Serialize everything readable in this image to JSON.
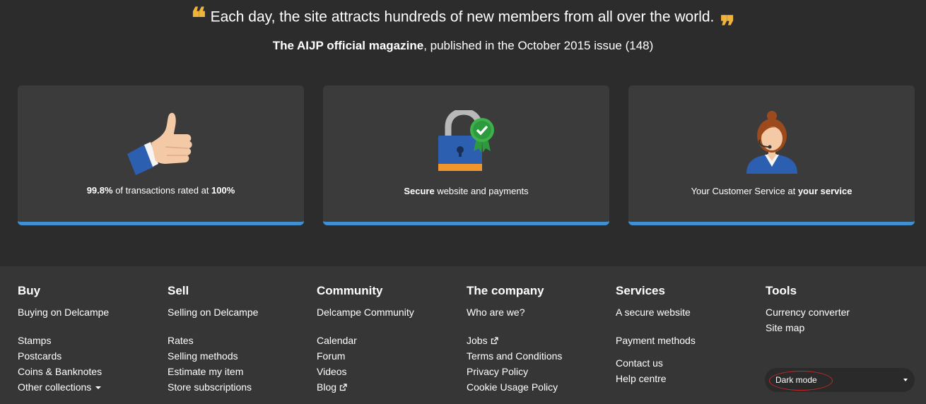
{
  "quote": {
    "open_mark": "❝",
    "text": "Each day, the site attracts hundreds of new members from all over the world.",
    "close_mark": "❞",
    "source_bold": "The AIJP official magazine",
    "source_rest": ", published in the October 2015 issue (148)"
  },
  "cards": [
    {
      "icon": "thumbs-up-icon",
      "bold_lead": "99.8%",
      "text_mid": " of transactions rated at ",
      "bold_tail": "100%"
    },
    {
      "icon": "secure-lock-icon",
      "bold_lead": "Secure",
      "text_mid": " website and payments",
      "bold_tail": ""
    },
    {
      "icon": "customer-service-icon",
      "bold_lead": "",
      "text_mid": "Your Customer Service at ",
      "bold_tail": "your service"
    }
  ],
  "footer": {
    "buy": {
      "title": "Buy",
      "items": [
        "Buying on Delcampe",
        "Stamps",
        "Postcards",
        "Coins & Banknotes",
        "Other collections"
      ]
    },
    "sell": {
      "title": "Sell",
      "items": [
        "Selling on Delcampe",
        "Rates",
        "Selling methods",
        "Estimate my item",
        "Store subscriptions"
      ]
    },
    "community": {
      "title": "Community",
      "items": [
        "Delcampe Community",
        "Calendar",
        "Forum",
        "Videos",
        "Blog"
      ]
    },
    "company": {
      "title": "The company",
      "items": [
        "Who are we?",
        "Jobs",
        "Terms and Conditions",
        "Privacy Policy",
        "Cookie Usage Policy"
      ]
    },
    "services": {
      "title": "Services",
      "items": [
        "A secure website",
        "Payment methods",
        "Contact us",
        "Help centre"
      ]
    },
    "tools": {
      "title": "Tools",
      "items": [
        "Currency converter",
        "Site map"
      ]
    }
  },
  "dark_mode": {
    "label": "Dark mode"
  },
  "colors": {
    "accent_blue": "#3f8fd2",
    "quote_gold": "#f0b43c",
    "highlight_red": "#c0282a"
  }
}
